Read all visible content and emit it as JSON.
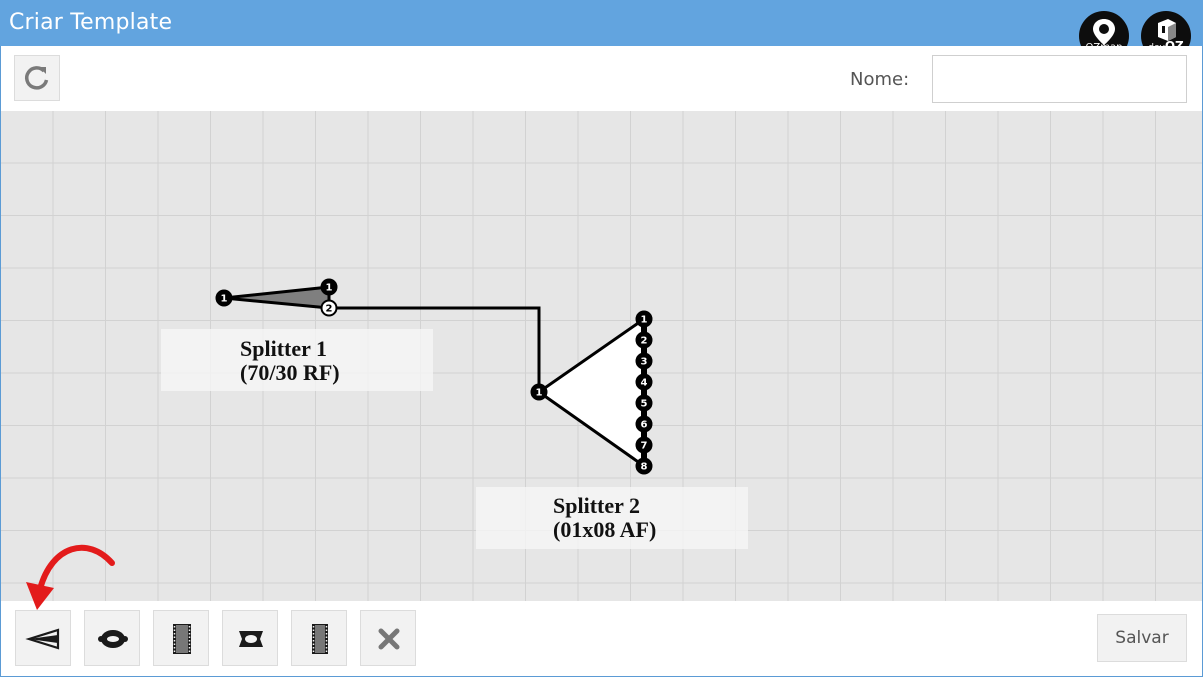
{
  "window": {
    "title": "Criar Template"
  },
  "logos": [
    {
      "icon": "ozmap-logo",
      "text": "OZmap"
    },
    {
      "icon": "devoz-logo",
      "text_prefix": "dev",
      "text_main": "OZ"
    }
  ],
  "header": {
    "refresh_icon": "refresh-icon",
    "name_label": "Nome:",
    "name_value": "",
    "name_placeholder": ""
  },
  "diagram": {
    "splitters": [
      {
        "name_line1": "Splitter 1",
        "name_line2": "(70/30 RF)",
        "input_ports": [
          "1"
        ],
        "output_ports": [
          "1",
          "2"
        ]
      },
      {
        "name_line1": "Splitter 2",
        "name_line2": "(01x08 AF)",
        "input_ports": [
          "1"
        ],
        "output_ports": [
          "1",
          "2",
          "3",
          "4",
          "5",
          "6",
          "7",
          "8"
        ]
      }
    ],
    "connection": "Splitter 1 port 2 → Splitter 2 port 1"
  },
  "footer": {
    "tools": [
      {
        "icon": "splitter-unbalanced-icon"
      },
      {
        "icon": "fusion-icon"
      },
      {
        "icon": "dio-icon"
      },
      {
        "icon": "connector-icon"
      },
      {
        "icon": "cable-tray-icon"
      },
      {
        "icon": "delete-icon"
      }
    ],
    "save_label": "Salvar"
  },
  "colors": {
    "titlebar": "#62a4df",
    "canvas": "#e6e6e6",
    "annotation_arrow": "#e31b1b"
  }
}
